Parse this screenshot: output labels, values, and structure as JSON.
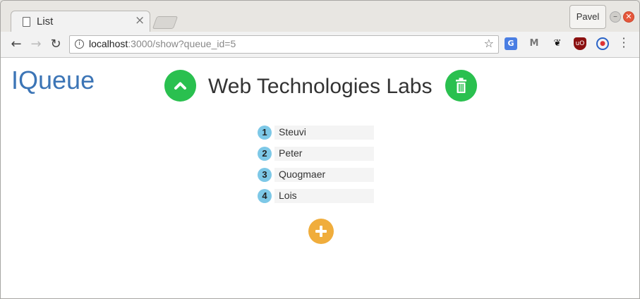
{
  "browser": {
    "tab_title": "List",
    "tab_close": "×",
    "profile_name": "Pavel",
    "url_host": "localhost",
    "url_rest": ":3000/show?queue_id=5"
  },
  "page": {
    "brand": "IQueue",
    "title": "Web Technologies Labs",
    "queue": [
      {
        "position": "1",
        "name": "Steuvi"
      },
      {
        "position": "2",
        "name": "Peter"
      },
      {
        "position": "3",
        "name": "Quogmaer"
      },
      {
        "position": "4",
        "name": "Lois"
      }
    ]
  },
  "colors": {
    "brand": "#3c75b6",
    "green_button": "#2ac04f",
    "badge": "#7dc8e7",
    "add_button": "#f0ad3c"
  },
  "icons": {
    "up": "chevron-up-icon",
    "trash": "trash-icon",
    "add": "plus-icon"
  }
}
